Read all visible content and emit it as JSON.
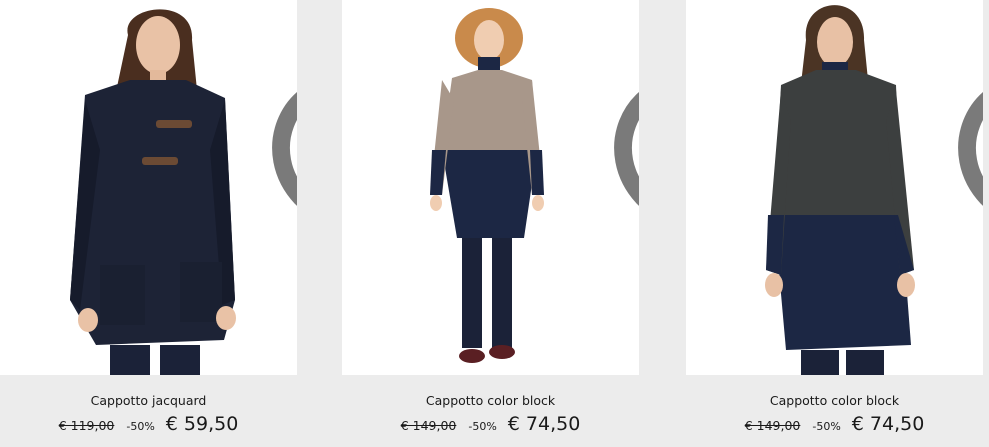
{
  "products": [
    {
      "name": "Cappotto jacquard",
      "old_price": "€ 119,00",
      "discount": "-50%",
      "price": "€ 59,50",
      "wishlist_icon": "heart-outline-icon"
    },
    {
      "name": "Cappotto color block",
      "old_price": "€ 149,00",
      "discount": "-50%",
      "price": "€ 74,50",
      "wishlist_icon": "heart-outline-icon"
    },
    {
      "name": "Cappotto color block",
      "old_price": "€ 149,00",
      "discount": "-50%",
      "price": "€ 74,50",
      "wishlist_icon": "heart-outline-icon"
    }
  ],
  "colors": {
    "background": "#ececec",
    "card": "#ffffff",
    "navy": "#1c2744",
    "camel": "#a8978a",
    "charcoal": "#3c3f3f"
  }
}
